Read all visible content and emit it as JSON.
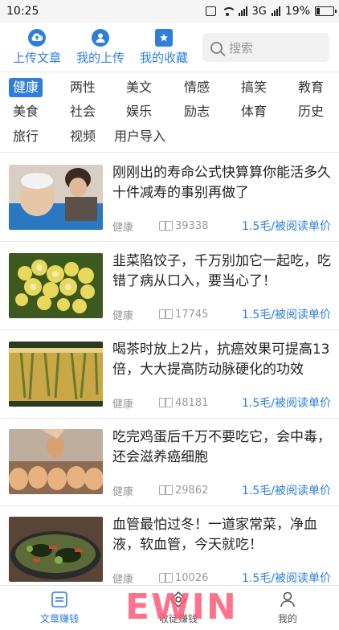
{
  "status_bar": {
    "time": "10:25",
    "network": "3G",
    "battery": "19%"
  },
  "top_nav": {
    "upload_article": "上传文章",
    "my_uploads": "我的上传",
    "my_favorites": "我的收藏",
    "search_placeholder": "搜索"
  },
  "categories": [
    "健康",
    "两性",
    "美文",
    "情感",
    "搞笑",
    "教育",
    "美食",
    "社会",
    "娱乐",
    "励志",
    "体育",
    "历史",
    "旅行",
    "视频",
    "用户导入"
  ],
  "active_category": "健康",
  "articles": [
    {
      "title": "刚刚出的寿命公式快算算你能活多久十件减寿的事别再做了",
      "tag": "健康",
      "reads": "39338",
      "price": "1.5毛/被阅读单价"
    },
    {
      "title": "韭菜陷饺子，千万别加它一起吃，吃错了病从口入，要当心了！",
      "tag": "健康",
      "reads": "17745",
      "price": "1.5毛/被阅读单价"
    },
    {
      "title": "喝茶时放上2片，抗癌效果可提高13倍，大大提高防动脉硬化的功效",
      "tag": "健康",
      "reads": "48181",
      "price": "1.5毛/被阅读单价"
    },
    {
      "title": "吃完鸡蛋后千万不要吃它，会中毒，还会滋养癌细胞",
      "tag": "健康",
      "reads": "29862",
      "price": "1.5毛/被阅读单价"
    },
    {
      "title": "血管最怕过冬！一道家常菜，净血液，软血管，今天就吃！",
      "tag": "健康",
      "reads": "10026",
      "price": "1.5毛/被阅读单价"
    }
  ],
  "tab_bar": {
    "articles_earn": "文章赚钱",
    "apprentice_earn": "收徒赚钱",
    "mine": "我的"
  },
  "watermark": "EWIN",
  "colors": {
    "accent": "#2f7ed8",
    "watermark": "#ff5a78"
  }
}
